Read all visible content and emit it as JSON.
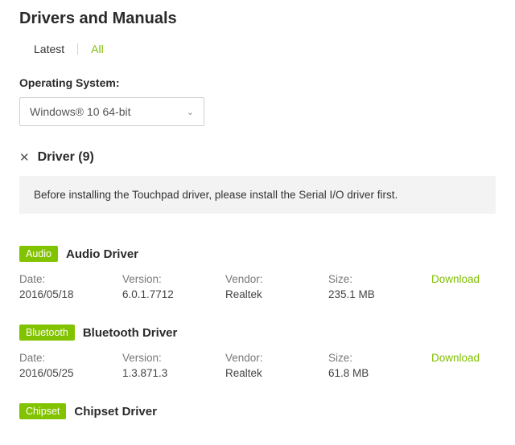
{
  "title": "Drivers and Manuals",
  "tabs": {
    "latest": "Latest",
    "all": "All"
  },
  "os": {
    "label": "Operating System:",
    "selected": "Windows® 10 64-bit"
  },
  "category": {
    "name": "Driver",
    "count": "(9)"
  },
  "notice": "Before installing the Touchpad driver, please install the Serial I/O driver first.",
  "labels": {
    "date": "Date:",
    "version": "Version:",
    "vendor": "Vendor:",
    "size": "Size:",
    "download": "Download"
  },
  "drivers": [
    {
      "badge": "Audio",
      "name": "Audio Driver",
      "date": "2016/05/18",
      "version": "6.0.1.7712",
      "vendor": "Realtek",
      "size": "235.1 MB"
    },
    {
      "badge": "Bluetooth",
      "name": "Bluetooth Driver",
      "date": "2016/05/25",
      "version": "1.3.871.3",
      "vendor": "Realtek",
      "size": "61.8 MB"
    },
    {
      "badge": "Chipset",
      "name": "Chipset Driver",
      "date": "",
      "version": "",
      "vendor": "",
      "size": ""
    }
  ]
}
